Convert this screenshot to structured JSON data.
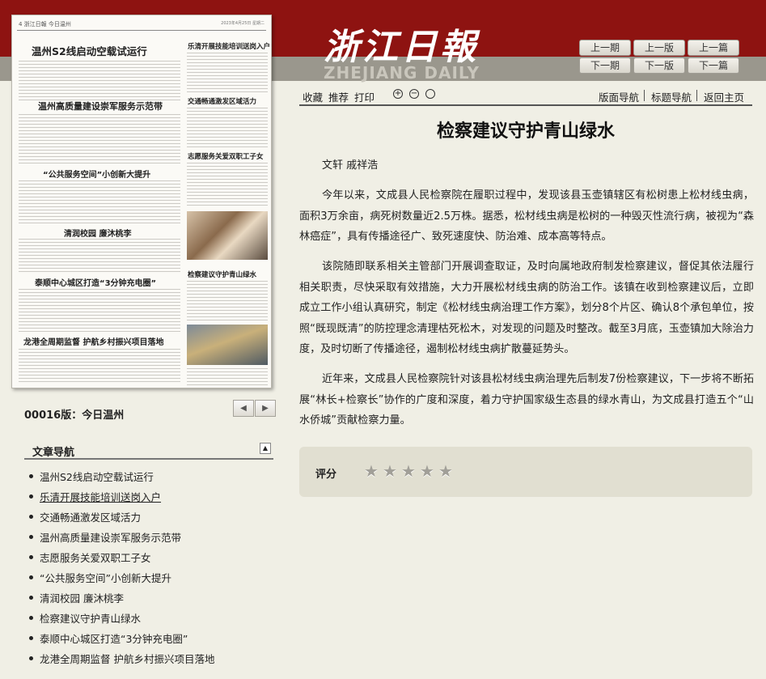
{
  "header": {
    "logo_cn": "浙江日報",
    "logo_en": "ZHEJIANG DAILY",
    "nav_buttons": [
      {
        "label": "上一期"
      },
      {
        "label": "上一版"
      },
      {
        "label": "上一篇"
      },
      {
        "label": "下一期"
      },
      {
        "label": "下一版"
      },
      {
        "label": "下一篇"
      }
    ]
  },
  "paper": {
    "page_header": "4 浙江日報 今日温州",
    "page_date": "2023年4月25日 星期二",
    "headlines": [
      "温州S2线启动空载试运行",
      "乐清开展技能培训送岗入户",
      "温州高质量建设崇军服务示范带",
      "交通畅通激发区域活力",
      "志愿服务关爱双职工子女",
      "“公共服务空间”小创新大提升",
      "清润校园 廉沐桃李",
      "检察建议守护青山绿水",
      "泰顺中心城区打造“3分钟充电圈”",
      "龙港全周期监督 护航乡村振兴项目落地"
    ]
  },
  "page_label": "00016版：今日温州",
  "pager": {
    "prev": "◀",
    "next": "▶"
  },
  "nav": {
    "title": "文章导航",
    "collapse": "▲",
    "items": [
      "温州S2线启动空载试运行",
      "乐清开展技能培训送岗入户",
      "交通畅通激发区域活力",
      "温州高质量建设崇军服务示范带",
      "志愿服务关爱双职工子女",
      "“公共服务空间”小创新大提升",
      "清润校园 廉沐桃李",
      "检察建议守护青山绿水",
      "泰顺中心城区打造“3分钟充电圈”",
      "龙港全周期监督 护航乡村振兴项目落地"
    ],
    "active_index": 1
  },
  "toolbar": {
    "collect": "收藏",
    "recommend": "推荐",
    "print": "打印",
    "zoom_in": "+",
    "zoom_out": "−",
    "zoom_reset": "",
    "layout_nav": "版面导航",
    "title_nav": "标题导航",
    "home": "返回主页"
  },
  "article": {
    "title": "检察建议守护青山绿水",
    "byline": "文轩 戚祥浩",
    "paragraphs": [
      "今年以来，文成县人民检察院在履职过程中，发现该县玉壶镇辖区有松树患上松材线虫病，面积3万余亩，病死树数量近2.5万株。据悉，松材线虫病是松树的一种毁灭性流行病，被视为“森林癌症”，具有传播途径广、致死速度快、防治难、成本高等特点。",
      "该院随即联系相关主管部门开展调查取证，及时向属地政府制发检察建议，督促其依法履行相关职责，尽快采取有效措施，大力开展松材线虫病的防治工作。该镇在收到检察建议后，立即成立工作小组认真研究，制定《松材线虫病治理工作方案》，划分8个片区、确认8个承包单位，按照“既现既清”的防控理念清理枯死松木，对发现的问题及时整改。截至3月底，玉壶镇加大除治力度，及时切断了传播途径，遏制松材线虫病扩散蔓延势头。",
      "近年来，文成县人民检察院针对该县松材线虫病治理先后制发7份检察建议，下一步将不断拓展“林长+检察长”协作的广度和深度，着力守护国家级生态县的绿水青山，为文成县打造五个“山水侨城”贡献检察力量。"
    ]
  },
  "rating": {
    "label": "评分",
    "stars": 5,
    "filled": 0
  },
  "colors": {
    "header_red": "#8e1311",
    "header_gray": "#9a978d",
    "page_bg": "#f0efe5"
  }
}
